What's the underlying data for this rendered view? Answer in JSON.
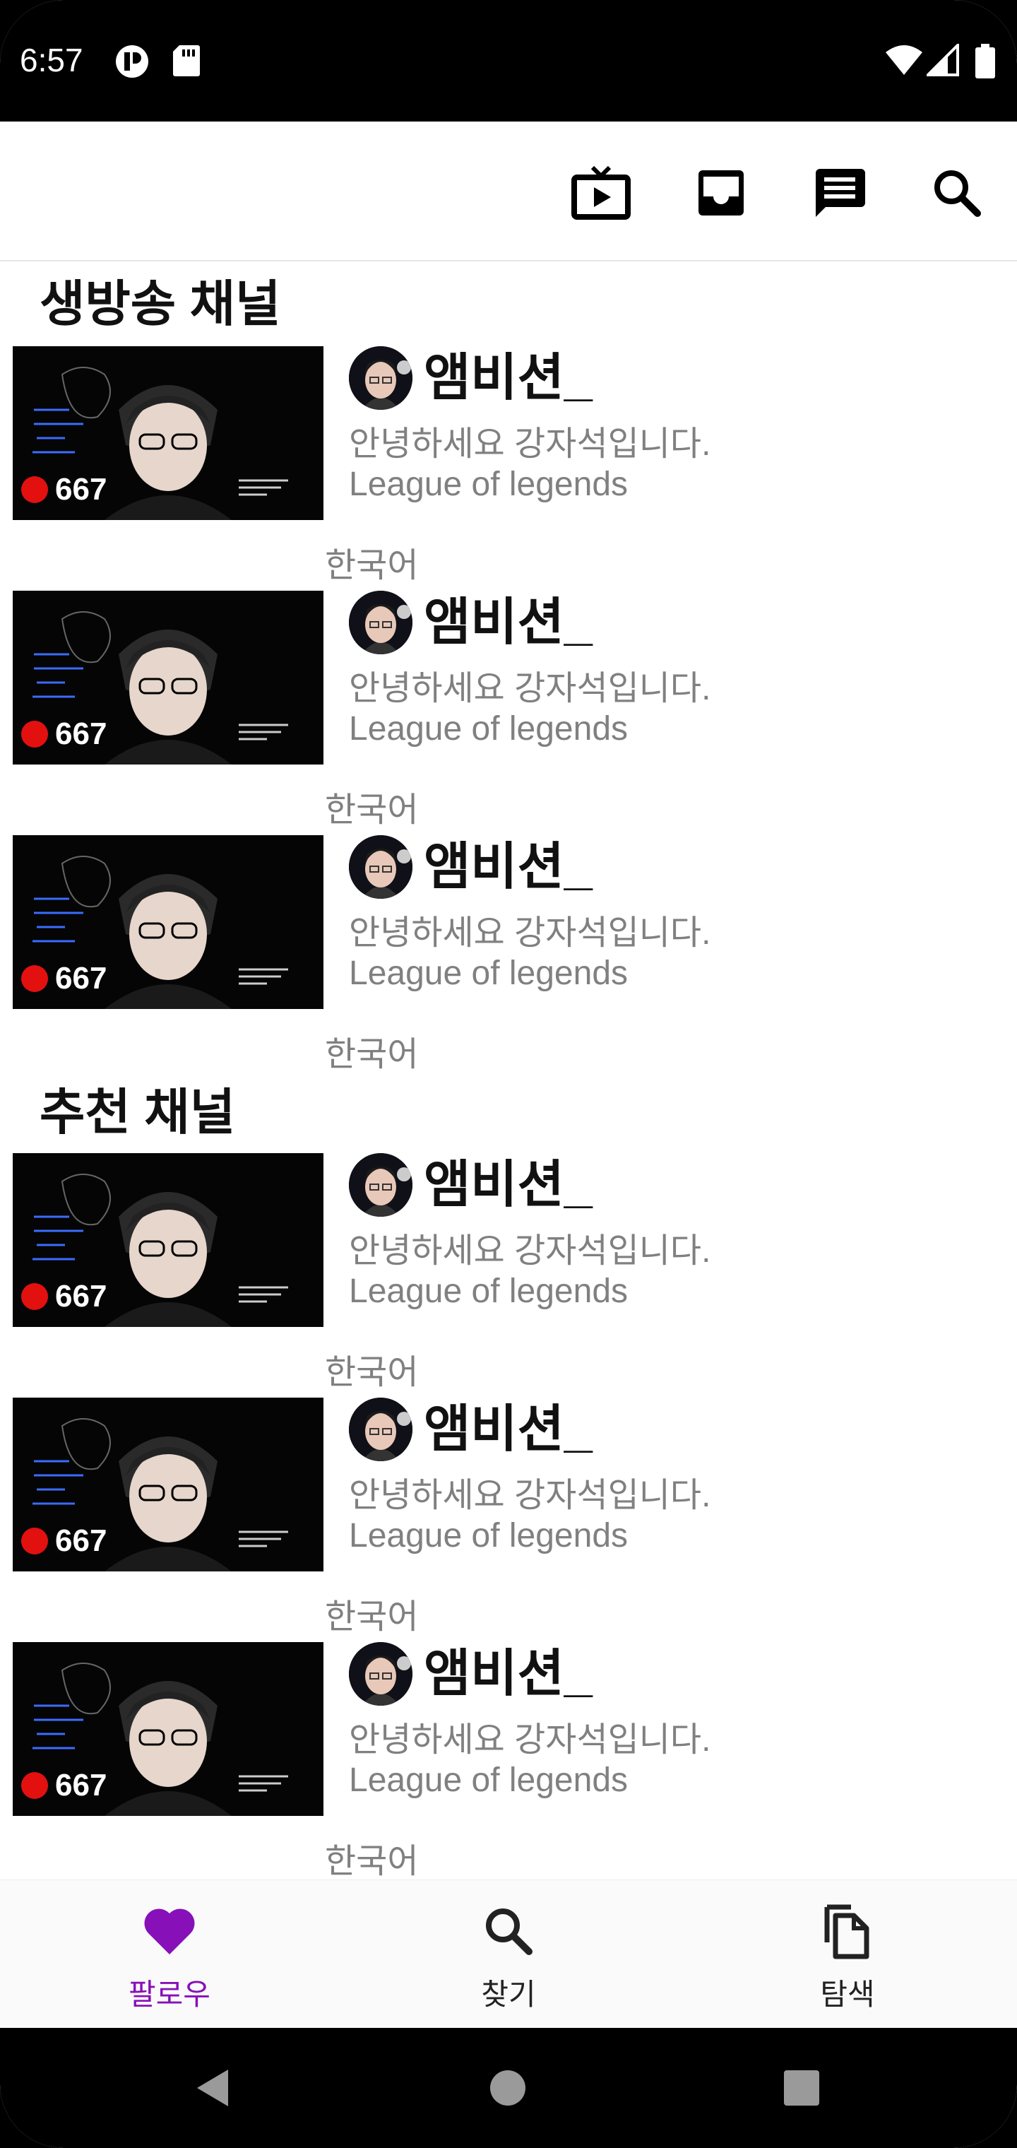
{
  "status_bar": {
    "time": "6:57"
  },
  "sections": [
    {
      "title": "생방송 채널",
      "channels": [
        {
          "name": "앰비션_",
          "title": "안녕하세요 강자석입니다.",
          "game": "League of legends",
          "language": "한국어",
          "viewers": "667"
        },
        {
          "name": "앰비션_",
          "title": "안녕하세요 강자석입니다.",
          "game": "League of legends",
          "language": "한국어",
          "viewers": "667"
        },
        {
          "name": "앰비션_",
          "title": "안녕하세요 강자석입니다.",
          "game": "League of legends",
          "language": "한국어",
          "viewers": "667"
        }
      ]
    },
    {
      "title": "추천 채널",
      "channels": [
        {
          "name": "앰비션_",
          "title": "안녕하세요 강자석입니다.",
          "game": "League of legends",
          "language": "한국어",
          "viewers": "667"
        },
        {
          "name": "앰비션_",
          "title": "안녕하세요 강자석입니다.",
          "game": "League of legends",
          "language": "한국어",
          "viewers": "667"
        },
        {
          "name": "앰비션_",
          "title": "안녕하세요 강자석입니다.",
          "game": "League of legends",
          "language": "한국어",
          "viewers": "667"
        }
      ]
    }
  ],
  "bottom_nav": {
    "items": [
      {
        "label": "팔로우",
        "icon": "heart-icon",
        "active": true
      },
      {
        "label": "찾기",
        "icon": "search-icon",
        "active": false
      },
      {
        "label": "탐색",
        "icon": "browse-icon",
        "active": false
      }
    ]
  },
  "colors": {
    "accent": "#8710b8",
    "live": "#e31010",
    "secondary_text": "#808080"
  }
}
